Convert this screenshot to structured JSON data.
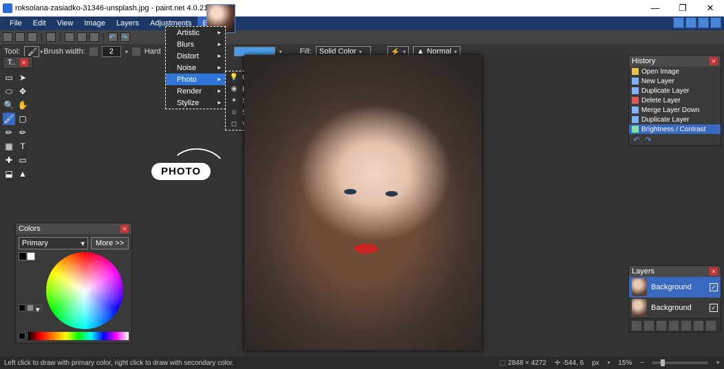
{
  "title": "roksolana-zasiadko-31346-unsplash.jpg - paint.net 4.0.21",
  "win": {
    "min": "—",
    "max": "❐",
    "close": "✕"
  },
  "menu": [
    "File",
    "Edit",
    "View",
    "Image",
    "Layers",
    "Adjustments",
    "Effects"
  ],
  "menu_active_index": 6,
  "effects_menu": [
    "Artistic",
    "Blurs",
    "Distort",
    "Noise",
    "Photo",
    "Render",
    "Stylize"
  ],
  "effects_active_index": 4,
  "photo_sub": [
    {
      "icon": "💡",
      "label": "Glow..."
    },
    {
      "icon": "◉",
      "label": "Red Eye Removal..."
    },
    {
      "icon": "✦",
      "label": "Sharpen..."
    },
    {
      "icon": "☺",
      "label": "Soften Portrait..."
    },
    {
      "icon": "◻",
      "label": "Vignette..."
    }
  ],
  "toolbar2": {
    "tool_label": "Tool:",
    "brush_label": "Brush width:",
    "brush_value": "2",
    "hardness_label": "Hard",
    "fill_label": "Fill:",
    "fill_value": "Solid Color",
    "blend_value": "Normal"
  },
  "doctab": {
    "label": "T..",
    "close": "×"
  },
  "tools_icons": [
    "▭",
    "➤",
    "⬭",
    "✥",
    "🔍",
    "✋",
    "🖌",
    "▢",
    "✏",
    "✏",
    "▦",
    "T",
    "✚",
    "▭",
    "⬓",
    "▲"
  ],
  "tools_selected_index": 6,
  "callout": "PHOTO",
  "history": {
    "title": "History",
    "items": [
      {
        "c": "#e7c24a",
        "t": "Open Image"
      },
      {
        "c": "#7fb3ff",
        "t": "New Layer"
      },
      {
        "c": "#7fb3ff",
        "t": "Duplicate Layer"
      },
      {
        "c": "#e05555",
        "t": "Delete Layer"
      },
      {
        "c": "#7fb3ff",
        "t": "Merge Layer Down"
      },
      {
        "c": "#7fb3ff",
        "t": "Duplicate Layer"
      },
      {
        "c": "#7fe0a0",
        "t": "Brightness / Contrast"
      }
    ],
    "selected_index": 6,
    "undo": "↶",
    "redo": "↷"
  },
  "layers": {
    "title": "Layers",
    "rows": [
      {
        "name": "Background",
        "checked": true,
        "sel": true
      },
      {
        "name": "Background",
        "checked": true,
        "sel": false
      }
    ]
  },
  "colors": {
    "title": "Colors",
    "mode": "Primary",
    "more": "More >>"
  },
  "status": {
    "hint": "Left click to draw with primary color, right click to draw with secondary color.",
    "dims": "2848 × 4272",
    "coords": "-544, 6",
    "unit": "px",
    "zoom": "15%"
  }
}
